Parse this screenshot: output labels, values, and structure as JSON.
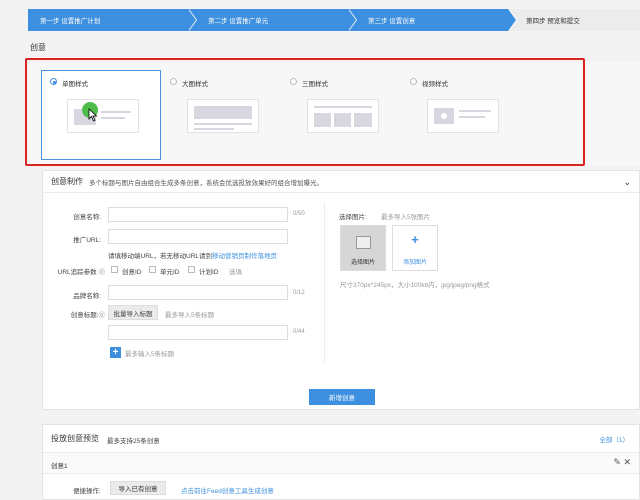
{
  "steps": [
    {
      "label": "第一步 设置推广计划",
      "state": "done"
    },
    {
      "label": "第二步 设置推广单元",
      "state": "done"
    },
    {
      "label": "第三步 设置创意",
      "state": "active"
    },
    {
      "label": "第四步 预览和提交",
      "state": "pending"
    }
  ],
  "section_title": "创意",
  "styles": [
    {
      "label": "单图样式",
      "selected": true
    },
    {
      "label": "大图样式",
      "selected": false
    },
    {
      "label": "三图样式",
      "selected": false
    },
    {
      "label": "视频样式",
      "selected": false
    }
  ],
  "panel": {
    "title": "创意制作",
    "description": "多个标题与图片自由组合生成多条创意，系统会优选投放效果好的组合增加曝光。",
    "fields": {
      "creative_name_label": "创意名称:",
      "creative_name_counter": "0/50",
      "promo_url_label": "推广URL:",
      "promo_url_hint_prefix": "请填移动端URL，若无移动URL请到",
      "promo_url_hint_link": "移动营销页制作落地页",
      "url_params_label": "URL追踪参数",
      "url_params_options": [
        "创意ID",
        "单元ID",
        "计划ID"
      ],
      "url_params_optional": "选填",
      "brand_label": "品牌名称:",
      "brand_counter": "0/12",
      "title_label": "创意标题:",
      "bulk_import_button": "批量导入标题",
      "title_limit_hint": "最多导入5条标题",
      "title_counter": "0/44",
      "add_title_hint": "最多输入5条标题"
    },
    "image": {
      "label": "选择图片:",
      "limit_hint": "最多导入5张图片",
      "choose_button": "选择图片",
      "add_button": "添加图片",
      "spec": "尺寸370px*245px，大小100kb内，jpg/jpeg/png格式"
    },
    "submit_button": "新增创意"
  },
  "preview": {
    "title": "投放创意预览",
    "subtitle": "最多支持25条创意",
    "all_link": "全部（1）",
    "row_name": "创意1",
    "ops_label": "便捷操作:",
    "import_button": "导入已有创意",
    "feed_link": "点击前往Feed创意工具生成创意"
  },
  "colors": {
    "primary": "#3d8fe0",
    "highlight": "#dd2222",
    "cursor": "#4fbb4a"
  }
}
